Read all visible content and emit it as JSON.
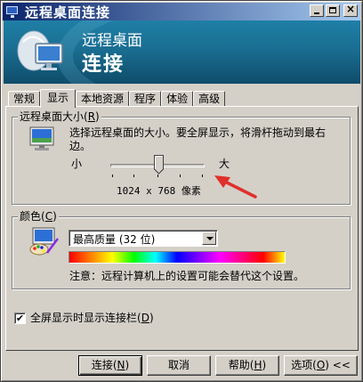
{
  "window": {
    "title": "远程桌面连接"
  },
  "banner": {
    "line1": "远程桌面",
    "line2": "连接"
  },
  "tabs": [
    {
      "label": "常规"
    },
    {
      "label": "显示"
    },
    {
      "label": "本地资源"
    },
    {
      "label": "程序"
    },
    {
      "label": "体验"
    },
    {
      "label": "高级"
    }
  ],
  "active_tab": "显示",
  "size_group": {
    "label": "远程桌面大小",
    "accel": "R",
    "description_line1": "选择远程桌面的大小。要全屏显示，将滑杆拖动到最右",
    "description_line2": "边。",
    "min_label": "小",
    "max_label": "大",
    "resolution": "1024 x 768 像素",
    "slider_position_fraction": 0.5
  },
  "color_group": {
    "label": "颜色",
    "accel": "C",
    "selected": "最高质量 (32 位)",
    "note": "注意：远程计算机上的设置可能会替代这个设置。"
  },
  "fullscreen_bar": {
    "label": "全屏显示时显示连接栏",
    "accel": "D",
    "checked": true,
    "check_mark": "✔"
  },
  "buttons": {
    "connect": {
      "label": "连接",
      "accel": "N"
    },
    "cancel": {
      "label": "取消"
    },
    "help": {
      "label": "帮助",
      "accel": "H"
    },
    "options": {
      "label": "选项",
      "accel": "O",
      "chevron": "<<"
    }
  },
  "colors": {
    "titlebar_start": "#0a246a",
    "titlebar_end": "#a6caf0",
    "banner": "#1a6e92",
    "dialog_face": "#d4d0c8",
    "annotation_arrow": "#e0302a"
  }
}
